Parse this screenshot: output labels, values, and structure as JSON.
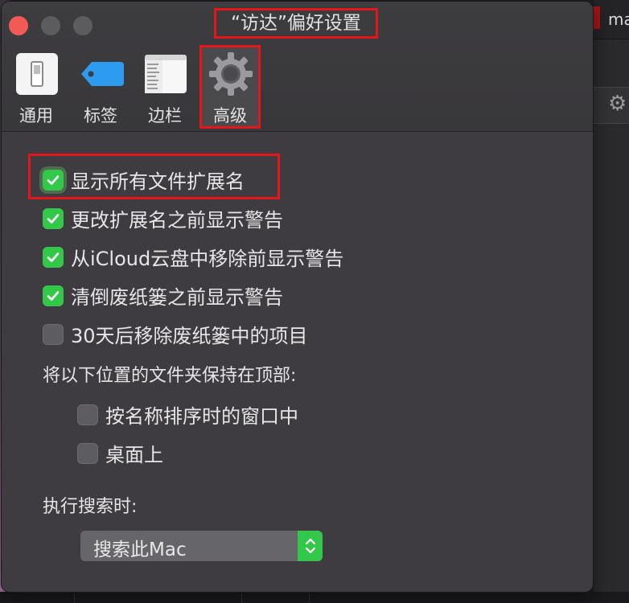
{
  "window": {
    "title": "“访达”偏好设置"
  },
  "toolbar": {
    "items": [
      {
        "label": "通用",
        "icon": "switch-icon"
      },
      {
        "label": "标签",
        "icon": "tag-icon"
      },
      {
        "label": "边栏",
        "icon": "sidebar-icon"
      },
      {
        "label": "高级",
        "icon": "gear-icon",
        "selected": true
      }
    ]
  },
  "options": [
    {
      "label": "显示所有文件扩展名",
      "checked": true
    },
    {
      "label": "更改扩展名之前显示警告",
      "checked": true
    },
    {
      "label": "从iCloud云盘中移除前显示警告",
      "checked": true
    },
    {
      "label": "清倒废纸篓之前显示警告",
      "checked": true
    },
    {
      "label": "30天后移除废纸篓中的项目",
      "checked": false
    }
  ],
  "folders_top": {
    "label": "将以下位置的文件夹保持在顶部:",
    "options": [
      {
        "label": "按名称排序时的窗口中",
        "checked": false
      },
      {
        "label": "桌面上",
        "checked": false
      }
    ]
  },
  "search": {
    "label": "执行搜索时:",
    "selected": "搜索此Mac"
  },
  "background": {
    "partial_text": "ma"
  },
  "colors": {
    "accent": "#34c84a",
    "highlight": "#e5161a"
  }
}
